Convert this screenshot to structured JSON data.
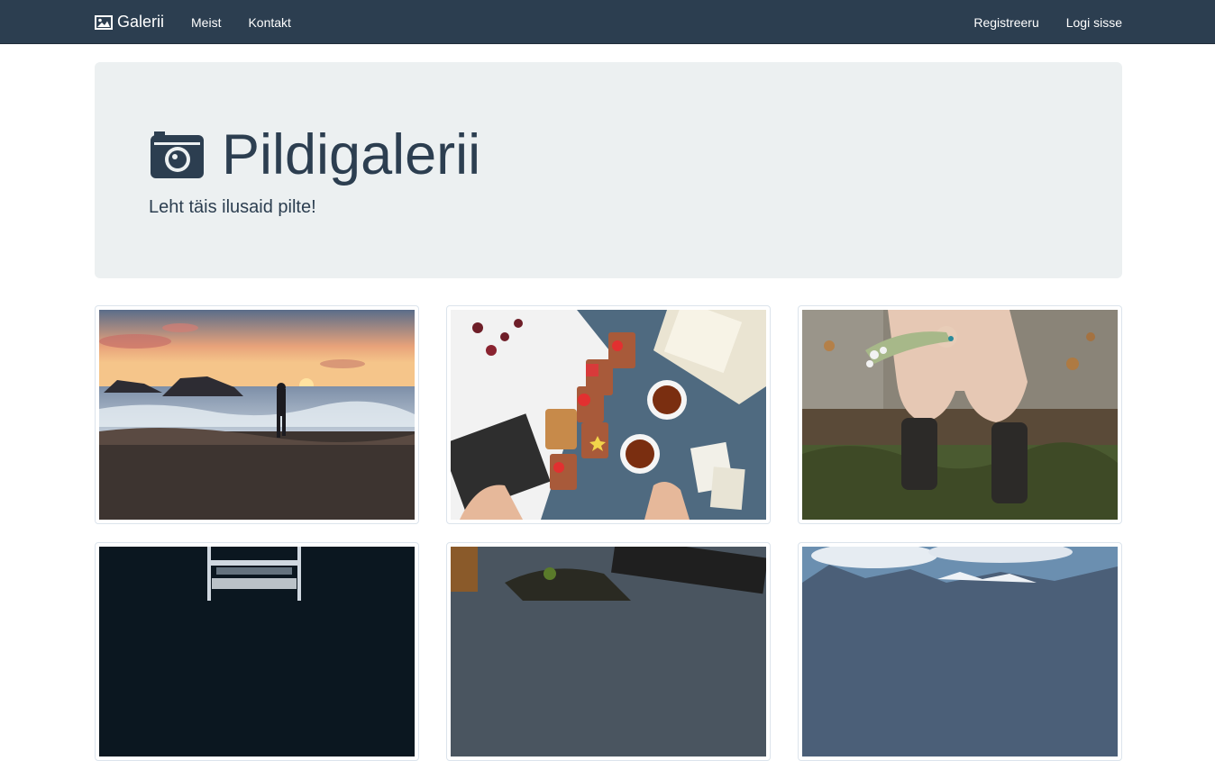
{
  "navbar": {
    "brand": "Galerii",
    "brand_icon": "image-icon",
    "links_left": [
      "Meist",
      "Kontakt"
    ],
    "links_right": [
      "Registreeru",
      "Logi sisse"
    ]
  },
  "jumbotron": {
    "title": "Pildigalerii",
    "title_icon": "camera-icon",
    "lead": "Leht täis ilusaid pilte!"
  },
  "gallery": {
    "items": [
      {
        "subject": "sunset-beach-photo"
      },
      {
        "subject": "tea-breakfast-photo"
      },
      {
        "subject": "flowers-boots-photo"
      },
      {
        "subject": "concert-stage-photo"
      },
      {
        "subject": "food-table-photo"
      },
      {
        "subject": "mountain-landscape-photo"
      }
    ]
  },
  "colors": {
    "navbar_bg": "#2c3e50",
    "jumbotron_bg": "#ecf0f1",
    "text": "#2c3e50",
    "thumb_border": "#dce4ec"
  }
}
